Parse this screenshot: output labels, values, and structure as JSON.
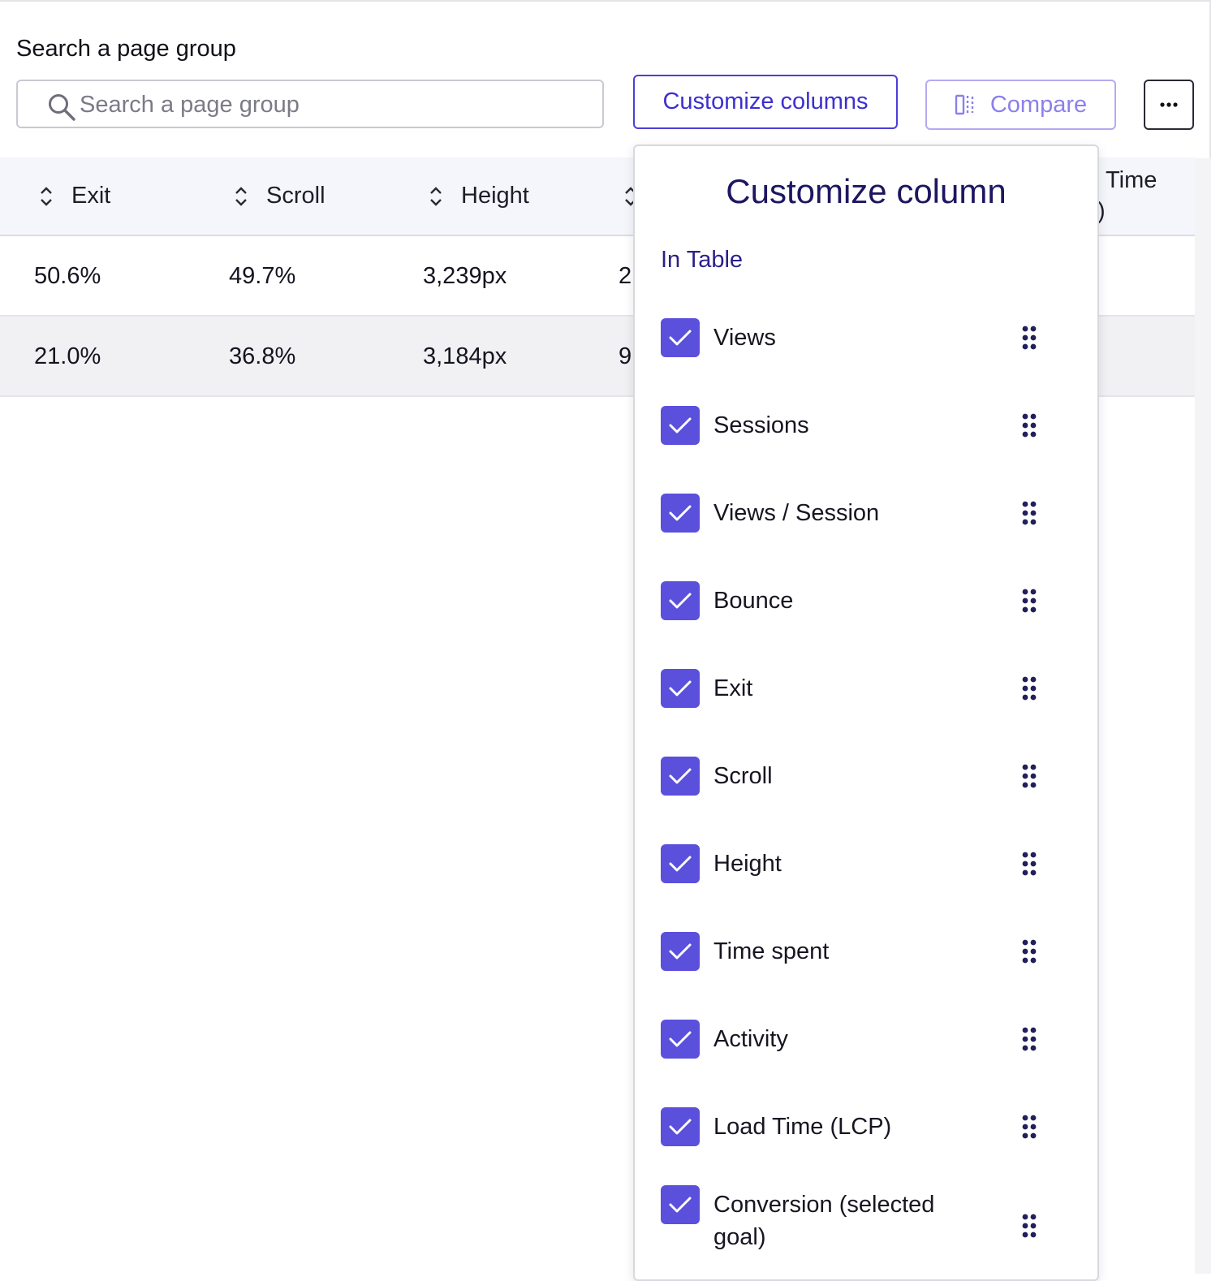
{
  "search": {
    "label": "Search a page group",
    "placeholder": "Search a page group",
    "value": ""
  },
  "toolbar": {
    "customize_label": "Customize columns",
    "compare_label": "Compare",
    "more_label": "···"
  },
  "table": {
    "headers": [
      "Exit",
      "Scroll",
      "Height",
      "Time",
      ")"
    ],
    "rows": [
      [
        "50.6%",
        "49.7%",
        "3,239px",
        "2"
      ],
      [
        "21.0%",
        "36.8%",
        "3,184px",
        "9"
      ]
    ]
  },
  "customize_panel": {
    "title": "Customize column",
    "section_label": "In Table",
    "items": [
      {
        "label": "Views",
        "checked": true
      },
      {
        "label": "Sessions",
        "checked": true
      },
      {
        "label": "Views / Session",
        "checked": true
      },
      {
        "label": "Bounce",
        "checked": true
      },
      {
        "label": "Exit",
        "checked": true
      },
      {
        "label": "Scroll",
        "checked": true
      },
      {
        "label": "Height",
        "checked": true
      },
      {
        "label": "Time spent",
        "checked": true
      },
      {
        "label": "Activity",
        "checked": true
      },
      {
        "label": "Load Time (LCP)",
        "checked": true
      },
      {
        "label": "Conversion (selected goal)",
        "checked": true
      }
    ]
  },
  "colors": {
    "accent": "#4b3fd8",
    "checkbox": "#5b50dc",
    "header_bg": "#f5f6fb",
    "title": "#1d1660"
  },
  "icons": {
    "search": "search-icon",
    "compare": "compare-icon",
    "sort": "sort-icon",
    "check": "check-icon",
    "drag": "drag-handle-icon"
  }
}
